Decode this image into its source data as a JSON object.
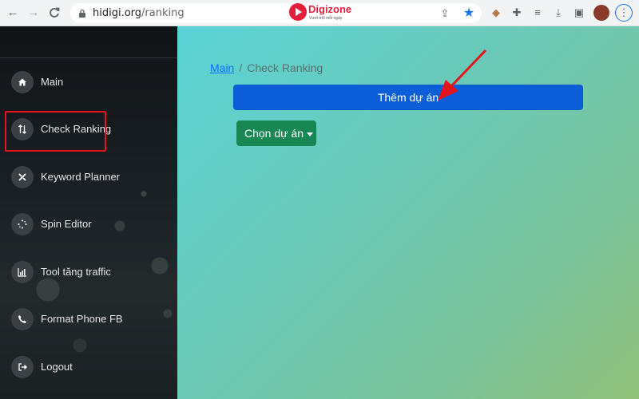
{
  "browser": {
    "url_host": "hidigi.org",
    "url_path": "/ranking",
    "icons": [
      "back-icon",
      "forward-icon",
      "reload-icon",
      "lock-icon",
      "share-icon",
      "star-icon",
      "extension-icon",
      "puzzle-icon",
      "media-icon",
      "download-icon",
      "sidepanel-icon",
      "profile-avatar",
      "menu-icon"
    ]
  },
  "watermark": {
    "brand": "Digizone",
    "tagline": "Vượt trội mỗi ngày"
  },
  "sidebar": {
    "items": [
      {
        "label": "Main",
        "icon": "home-icon"
      },
      {
        "label": "Check Ranking",
        "icon": "sort-icon"
      },
      {
        "label": "Keyword Planner",
        "icon": "tools-icon"
      },
      {
        "label": "Spin Editor",
        "icon": "spinner-icon"
      },
      {
        "label": "Tool tăng traffic",
        "icon": "bar-chart-icon"
      },
      {
        "label": "Format Phone FB",
        "icon": "phone-icon"
      },
      {
        "label": "Logout",
        "icon": "logout-icon"
      }
    ]
  },
  "main": {
    "breadcrumb": {
      "home": "Main",
      "separator": "/",
      "current": "Check Ranking"
    },
    "add_project_label": "Thêm dự án",
    "select_project_label": "Chọn dự án"
  },
  "colors": {
    "primary": "#0b5ed7",
    "success": "#198754",
    "annotation": "#e3141b",
    "sidebar_bg": "#1a2024"
  }
}
